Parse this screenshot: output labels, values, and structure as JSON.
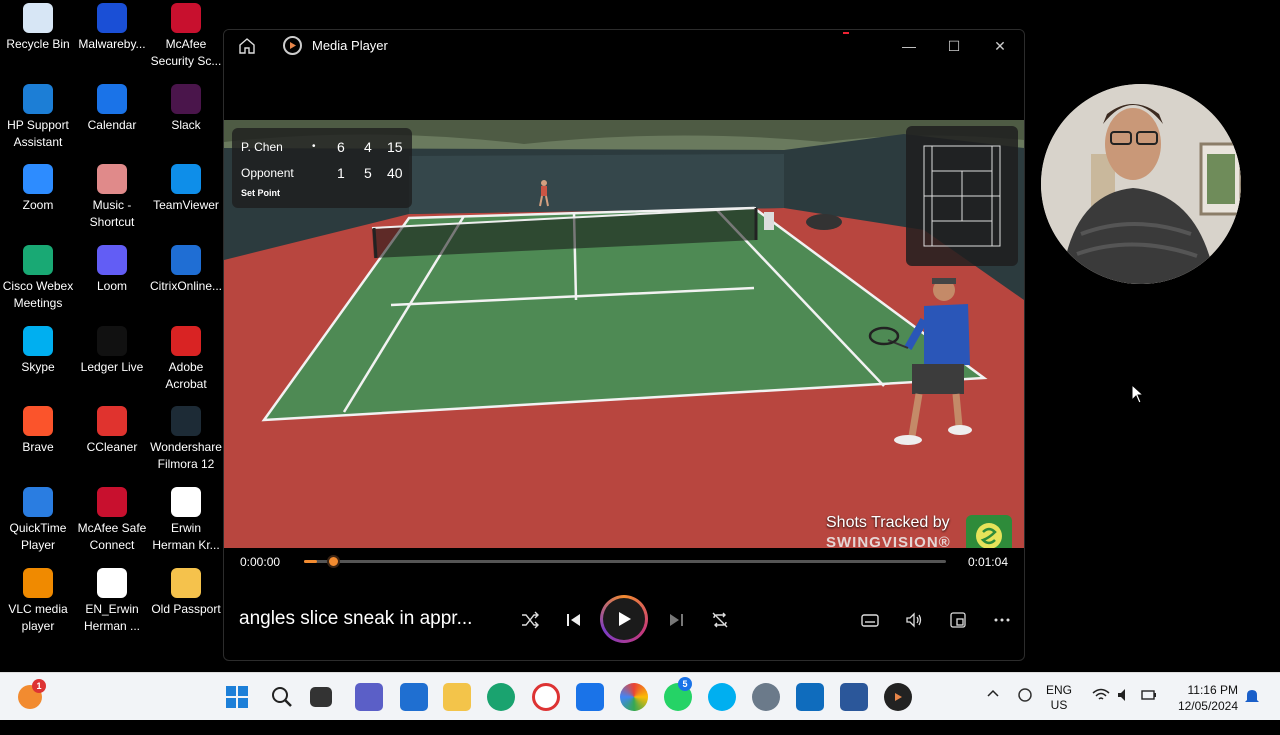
{
  "desktop_icons": [
    {
      "label": "Recycle Bin",
      "icon": "recycle-bin-icon",
      "color": "#d7e6f5"
    },
    {
      "label": "Malwareby...",
      "icon": "malwarebytes-icon",
      "color": "#1a4fd6"
    },
    {
      "label": "McAfee\nSecurity Sc...",
      "icon": "mcafee-icon",
      "color": "#c8102e"
    },
    {
      "label": "HP Support\nAssistant",
      "icon": "hp-support-icon",
      "color": "#1c7ed6"
    },
    {
      "label": "Calendar",
      "icon": "calendar-icon",
      "color": "#1a73e8"
    },
    {
      "label": "Slack",
      "icon": "slack-icon",
      "color": "#4a154b"
    },
    {
      "label": "Zoom",
      "icon": "zoom-icon",
      "color": "#2d8cff"
    },
    {
      "label": "Music -\nShortcut",
      "icon": "music-folder-icon",
      "color": "#e08a8a"
    },
    {
      "label": "TeamViewer",
      "icon": "teamviewer-icon",
      "color": "#0e8ee9"
    },
    {
      "label": "Cisco Webex\nMeetings",
      "icon": "webex-icon",
      "color": "#19a974"
    },
    {
      "label": "Loom",
      "icon": "loom-icon",
      "color": "#625df5"
    },
    {
      "label": "CitrixOnline...",
      "icon": "citrix-icon",
      "color": "#1f6ed4"
    },
    {
      "label": "Skype",
      "icon": "skype-icon",
      "color": "#00aff0"
    },
    {
      "label": "Ledger Live",
      "icon": "ledger-icon",
      "color": "#111111"
    },
    {
      "label": "Adobe\nAcrobat",
      "icon": "acrobat-icon",
      "color": "#d92323"
    },
    {
      "label": "Brave",
      "icon": "brave-icon",
      "color": "#fb542b"
    },
    {
      "label": "CCleaner",
      "icon": "ccleaner-icon",
      "color": "#e0332e"
    },
    {
      "label": "Wondershare\nFilmora 12",
      "icon": "filmora-icon",
      "color": "#1d2b36"
    },
    {
      "label": "QuickTime\nPlayer",
      "icon": "quicktime-icon",
      "color": "#2a7de1"
    },
    {
      "label": "McAfee Safe\nConnect",
      "icon": "mcafee-safe-connect-icon",
      "color": "#c8102e"
    },
    {
      "label": "Erwin\nHerman Kr...",
      "icon": "pdf-file-icon",
      "color": "#ffffff"
    },
    {
      "label": "VLC media\nplayer",
      "icon": "vlc-icon",
      "color": "#f08a00"
    },
    {
      "label": "EN_Erwin\nHerman ...",
      "icon": "pdf-file-icon",
      "color": "#ffffff"
    },
    {
      "label": "Old Passport",
      "icon": "folder-icon",
      "color": "#f5c24c"
    }
  ],
  "window": {
    "title": "Media Player",
    "minimize_glyph": "—",
    "maximize_glyph": "☐",
    "close_glyph": "✕"
  },
  "scoreboard": {
    "rows": [
      {
        "name": "P. Chen",
        "serve": "•",
        "s1": "6",
        "s2": "4",
        "s3": "15"
      },
      {
        "name": "Opponent",
        "serve": "",
        "s1": "1",
        "s2": "5",
        "s3": "40"
      }
    ],
    "status": "Set Point"
  },
  "watermark": {
    "line1": "Shots Tracked by",
    "line2": "SWINGVISION®"
  },
  "player": {
    "current_time": "0:00:00",
    "total_time": "0:01:04",
    "progress": 0.02,
    "media_title": "angles slice sneak in appr..."
  },
  "taskbar": {
    "notification_badge": "1",
    "whatsapp_badge": "5",
    "language": "ENG",
    "region": "US",
    "time": "11:16 PM",
    "date": "12/05/2024"
  },
  "colors": {
    "accent": "#f28b30",
    "court_green": "#4e8a54",
    "court_red": "#b8463f"
  }
}
